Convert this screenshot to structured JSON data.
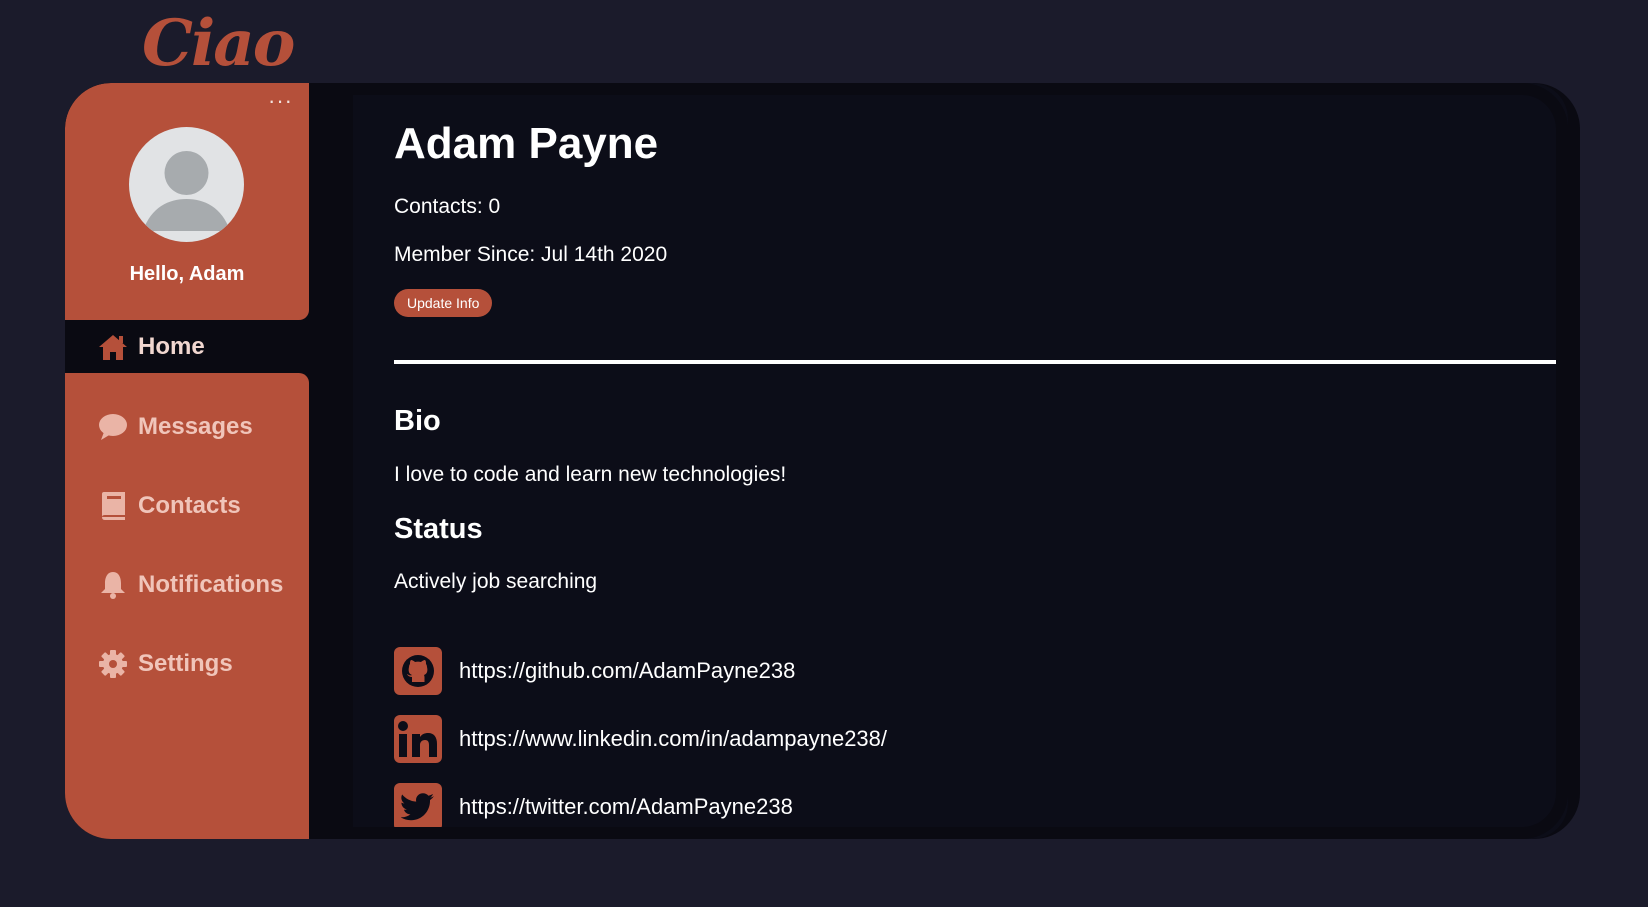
{
  "logo": {
    "text": "Ciao"
  },
  "sidebar": {
    "greeting": "Hello, Adam",
    "more_label": "···",
    "nav": [
      {
        "label": "Home",
        "icon": "home-icon",
        "active": true
      },
      {
        "label": "Messages",
        "icon": "chat-bubble-icon",
        "active": false
      },
      {
        "label": "Contacts",
        "icon": "book-icon",
        "active": false
      },
      {
        "label": "Notifications",
        "icon": "bell-icon",
        "active": false
      },
      {
        "label": "Settings",
        "icon": "gear-icon",
        "active": false
      }
    ]
  },
  "profile": {
    "name": "Adam Payne",
    "contacts": "Contacts: 0",
    "member_since": "Member Since: Jul 14th 2020",
    "update_button": "Update Info"
  },
  "bio": {
    "heading": "Bio",
    "text": "I love to code and learn new technologies!"
  },
  "status": {
    "heading": "Status",
    "text": "Actively job searching"
  },
  "social": [
    {
      "icon": "github-icon",
      "url": "https://github.com/AdamPayne238"
    },
    {
      "icon": "linkedin-icon",
      "url": "https://www.linkedin.com/in/adampayne238/"
    },
    {
      "icon": "twitter-icon",
      "url": "https://twitter.com/AdamPayne238"
    }
  ],
  "colors": {
    "accent": "#b5503a",
    "background": "#1b1b2b",
    "panel": "#0c0d18"
  }
}
